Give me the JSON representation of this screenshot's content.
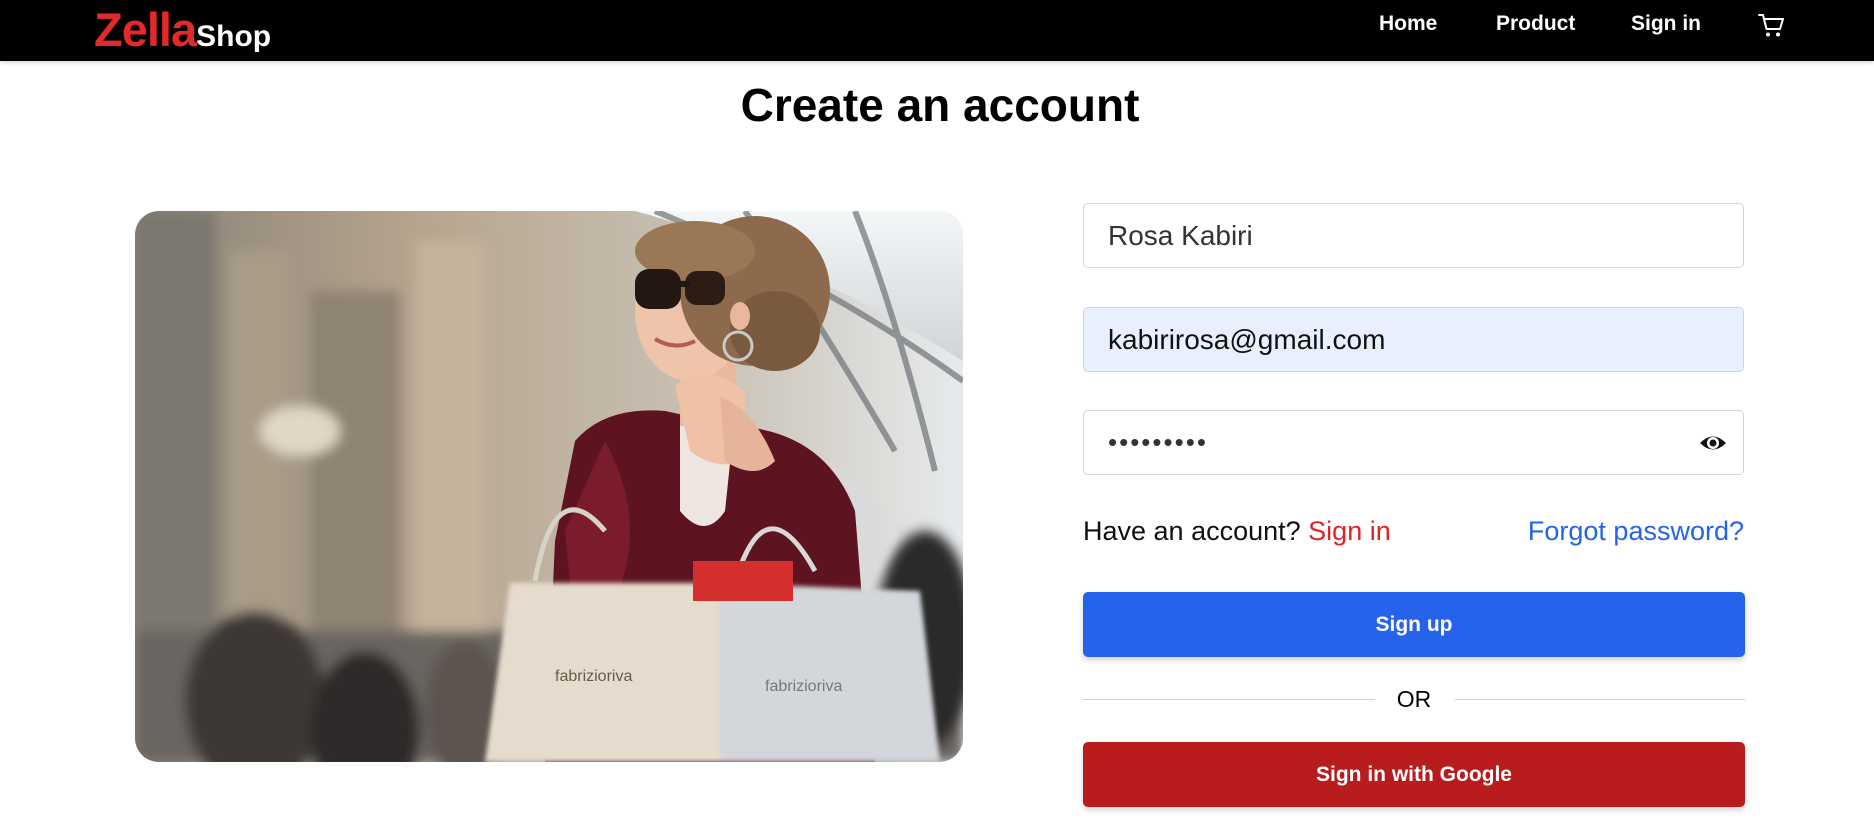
{
  "brand": {
    "name_main": "Zella",
    "name_sub": "Shop"
  },
  "nav": {
    "home": "Home",
    "product": "Product",
    "signin": "Sign in",
    "cart_icon": "cart-icon"
  },
  "page": {
    "title": "Create an account"
  },
  "form": {
    "name_value": "Rosa Kabiri",
    "email_value": "kabirirosa@gmail.com",
    "password_value": "•••••••••",
    "eye_icon": "eye-icon",
    "have_account": "Have an account?",
    "signin_link": "Sign in",
    "forgot": "Forgot password?",
    "signup_button": "Sign up",
    "or": "OR",
    "google_button": "Sign in with Google"
  },
  "colors": {
    "brand_red": "#e22a2a",
    "primary_blue": "#2563eb",
    "google_red": "#b91c1c",
    "autofill_bg": "#e8f0fe"
  }
}
